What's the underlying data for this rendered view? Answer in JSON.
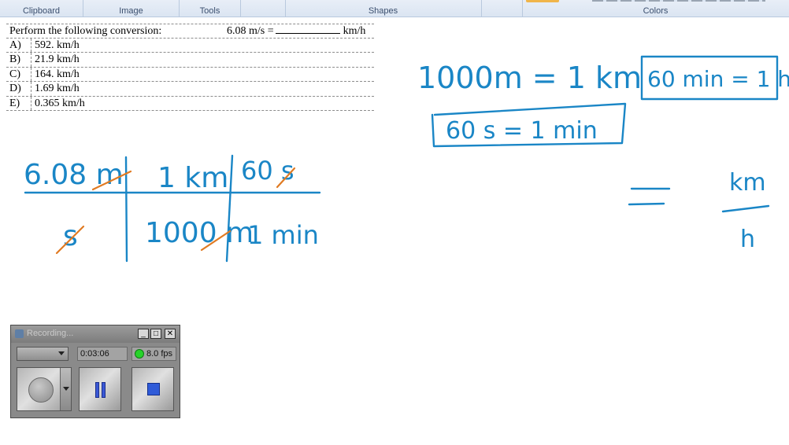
{
  "ribbon": {
    "groups": [
      "Clipboard",
      "Image",
      "Tools",
      "Shapes",
      "Colors"
    ]
  },
  "question": {
    "stem": "Perform the following conversion:",
    "value": "6.08 m/s =",
    "unit": "km/h",
    "options": [
      {
        "key": "A)",
        "text": "592. km/h"
      },
      {
        "key": "B)",
        "text": "21.9 km/h"
      },
      {
        "key": "C)",
        "text": "164. km/h"
      },
      {
        "key": "D)",
        "text": "1.69 km/h"
      },
      {
        "key": "E)",
        "text": "0.365 km/h"
      }
    ]
  },
  "handwriting": {
    "fact1": "1000m = 1 km",
    "fact2": "60 min = 1 hr",
    "fact3": "60 s = 1 min",
    "grid": {
      "top": [
        "6.08 m",
        "1 km",
        "60 s"
      ],
      "bottom": [
        "s",
        "1000 m",
        "1 min"
      ]
    },
    "result_unit_top": "km",
    "result_unit_bottom": "h"
  },
  "recorder": {
    "title": "Recording...",
    "elapsed": "0:03:06",
    "fps": "8.0 fps",
    "colors": {
      "status": "#27d32a",
      "button_icon": "#2f5bd8"
    }
  }
}
